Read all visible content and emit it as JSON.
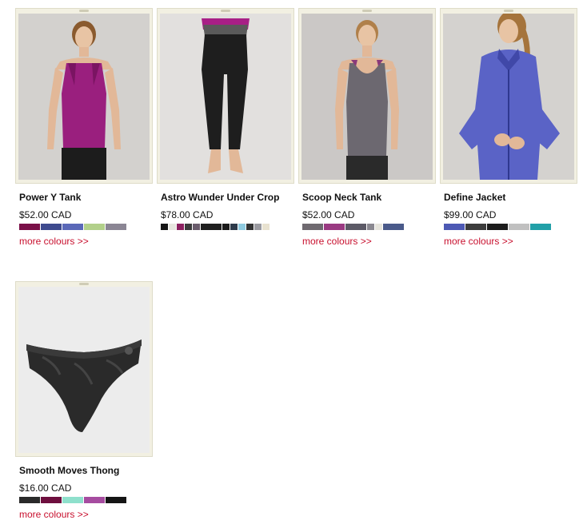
{
  "products": [
    {
      "name": "Power Y Tank",
      "price": "$52.00 CAD",
      "more": "more colours >>",
      "image": "woman-in-magenta-tank",
      "swatches": [
        "#7a1048",
        "#3e4a8e",
        "#5a68b8",
        "#b2d08a",
        "#8b8694"
      ]
    },
    {
      "name": "Astro Wunder Under Crop",
      "price": "$78.00 CAD",
      "more": "",
      "image": "black-crop-leggings",
      "swatches": [
        "#151515",
        "#e7e6df",
        "#8c2060",
        "#3b3b3b",
        "#6a5c6c",
        "#1f1f1f",
        "#1a1a1a",
        "#2d3a4a",
        "#8fcbe0",
        "#333333",
        "#9a9aa0",
        "#e8e2d0"
      ]
    },
    {
      "name": "Scoop Neck Tank",
      "price": "$52.00 CAD",
      "more": "more colours >>",
      "image": "woman-in-grey-scoop-tank",
      "swatches": [
        "#6f6a70",
        "#9a3a82",
        "#5c5a66",
        "#8a8890",
        "#e6e4dc",
        "#4a5a8a"
      ]
    },
    {
      "name": "Define Jacket",
      "price": "$99.00 CAD",
      "more": "more colours >>",
      "image": "woman-in-blue-jacket",
      "swatches": [
        "#4d59b4",
        "#3c3c3c",
        "#1c1c1c",
        "#c0c0c0",
        "#22a0a8"
      ]
    },
    {
      "name": "Smooth Moves Thong",
      "price": "$16.00 CAD",
      "more": "more colours >>",
      "image": "black-lace-thong",
      "swatches": [
        "#2a2a2a",
        "#6e0f3e",
        "#8fe0cc",
        "#a64ca0",
        "#151515"
      ]
    }
  ]
}
